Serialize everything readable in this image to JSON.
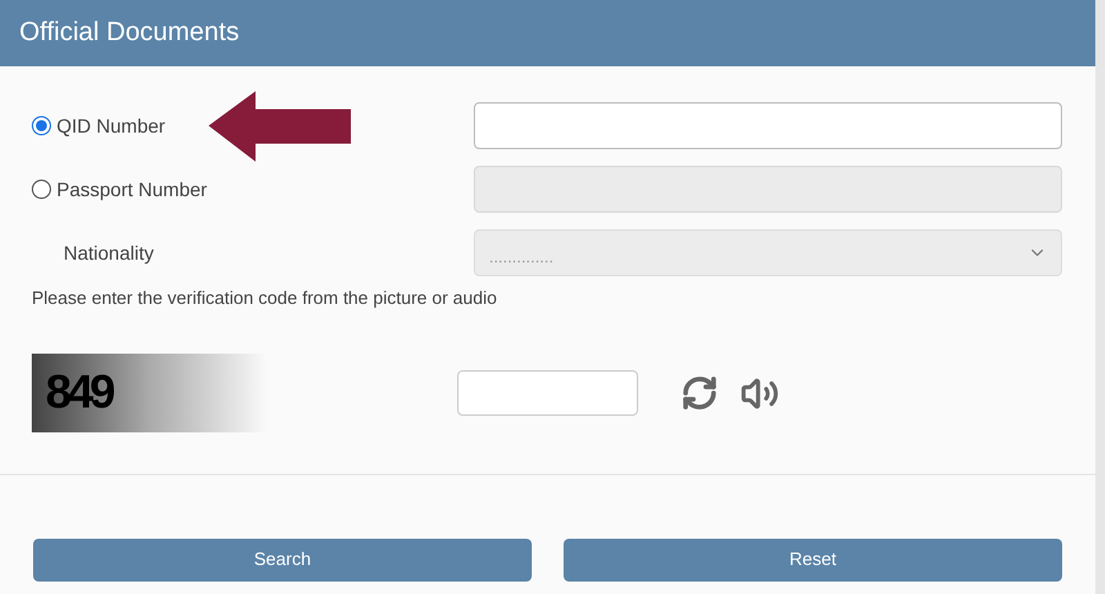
{
  "header": {
    "title": "Official Documents"
  },
  "id_options": [
    {
      "label": "QID Number",
      "selected": true
    },
    {
      "label": "Passport Number",
      "selected": false
    }
  ],
  "fields": [
    {
      "disabled": false
    },
    {
      "disabled": true
    }
  ],
  "nationality": {
    "label": "Nationality",
    "value": "..............",
    "disabled": true
  },
  "instructions": "Please enter the verification code from the picture or audio",
  "captcha": {
    "code": "849"
  },
  "buttons": [
    "Search",
    "Reset"
  ]
}
